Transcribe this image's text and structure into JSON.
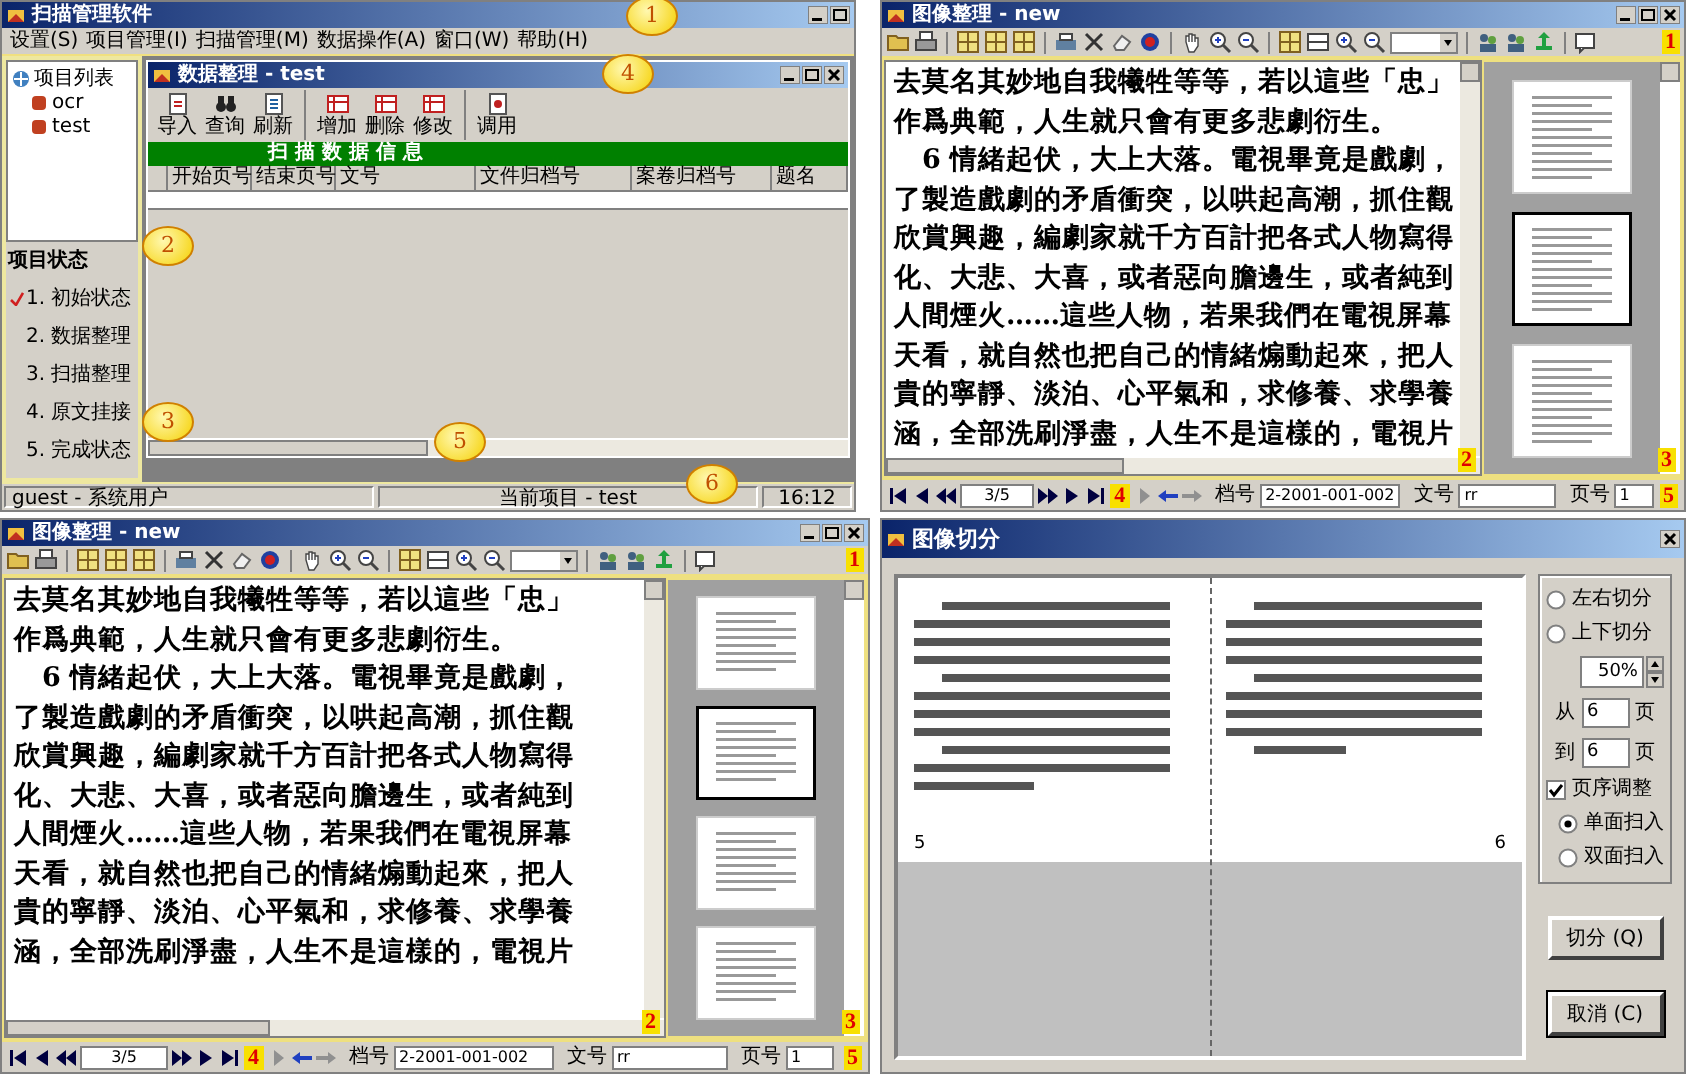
{
  "project_window": {
    "title": "扫描管理软件",
    "menu": [
      "设置(S)",
      "项目管理(I)",
      "扫描管理(M)",
      "数据操作(A)",
      "窗口(W)",
      "帮助(H)"
    ],
    "tree": [
      {
        "label": "项目列表",
        "children": [
          {
            "label": "ocr"
          },
          {
            "label": "test"
          }
        ]
      }
    ],
    "status_panel": {
      "title": "项目状态",
      "items": [
        {
          "label": "1. 初始状态",
          "checked": true
        },
        {
          "label": "2. 数据整理",
          "checked": false
        },
        {
          "label": "3. 扫描整理",
          "checked": false
        },
        {
          "label": "4. 原文挂接",
          "checked": false
        },
        {
          "label": "5. 完成状态",
          "checked": false
        }
      ]
    },
    "data_window": {
      "title": "数据整理 - test",
      "toolbar": [
        "导入",
        "查询",
        "刷新",
        "增加",
        "删除",
        "修改",
        "调用"
      ],
      "banner": "扫 描 数 据 信 息",
      "columns": [
        "开始页号",
        "结束页号",
        "文号",
        "文件归档号",
        "案卷归档号",
        "题名"
      ]
    },
    "status_bar": [
      "guest - 系统用户",
      "当前项目 - test",
      "16:12"
    ],
    "callouts": [
      "1",
      "2",
      "3",
      "4",
      "5",
      "6"
    ]
  },
  "image_windows": [
    {
      "title": "图像整理 - new",
      "lines": [
        "去莫名其妙地自我犧牲等等，若以這些「忠」",
        "作爲典範，人生就只會有更多悲劇衍生。",
        "6 情緒起伏，大上大落。電視畢竟是戲劇，",
        "了製造戲劇的矛盾衝突，以哄起高潮，抓住觀",
        "欣賞興趣，編劇家就千方百計把各式人物寫得",
        "化、大悲、大喜，或者惡向膽邊生，或者純到",
        "人間煙火……這些人物，若果我們在電視屏幕",
        "天看，就自然也把自己的情緒煽動起來，把人",
        "貴的寧靜、淡泊、心平氣和，求修養、求學養",
        "涵，全部洗刷淨盡，人生不是這樣的，電視片"
      ],
      "thumbnails": [
        {
          "selected": false
        },
        {
          "selected": true
        },
        {
          "selected": false
        }
      ],
      "nav": {
        "page": "3/5",
        "fields": [
          {
            "label": "档号",
            "value": "2-2001-001-002"
          },
          {
            "label": "文号",
            "value": "rr"
          },
          {
            "label": "页号",
            "value": "1"
          }
        ]
      },
      "callouts": [
        "1",
        "2",
        "3",
        "4",
        "5"
      ]
    },
    {
      "title": "图像整理 - new",
      "lines": [
        "去莫名其妙地自我犧牲等等，若以這些「忠」",
        "作爲典範，人生就只會有更多悲劇衍生。",
        "6 情緒起伏，大上大落。電視畢竟是戲劇，",
        "了製造戲劇的矛盾衝突，以哄起高潮，抓住觀",
        "欣賞興趣，編劇家就千方百計把各式人物寫得",
        "化、大悲、大喜，或者惡向膽邊生，或者純到",
        "人間煙火……這些人物，若果我們在電視屏幕",
        "天看，就自然也把自己的情緒煽動起來，把人",
        "貴的寧靜、淡泊、心平氣和，求修養、求學養",
        "涵，全部洗刷淨盡，人生不是這樣的，電視片"
      ],
      "thumbnails": [
        {
          "selected": false
        },
        {
          "selected": true
        },
        {
          "selected": false
        },
        {
          "selected": false
        }
      ],
      "nav": {
        "page": "3/5",
        "fields": [
          {
            "label": "档号",
            "value": "2-2001-001-002"
          },
          {
            "label": "文号",
            "value": "rr"
          },
          {
            "label": "页号",
            "value": "1"
          }
        ]
      },
      "callouts": [
        "1",
        "2",
        "3",
        "4",
        "5"
      ]
    }
  ],
  "split_dialog": {
    "title": "图像切分",
    "page_numbers": [
      "5",
      "6"
    ],
    "split_modes": [
      {
        "label": "左右切分",
        "selected": false
      },
      {
        "label": "上下切分",
        "selected": false
      }
    ],
    "ratio": "50%",
    "range": [
      {
        "label": "从",
        "value": "6",
        "unit": "页"
      },
      {
        "label": "到",
        "value": "6",
        "unit": "页"
      }
    ],
    "reorder": {
      "label": "页序调整",
      "checked": true
    },
    "scan_modes": [
      {
        "label": "单面扫入",
        "selected": true
      },
      {
        "label": "双面扫入",
        "selected": false
      }
    ],
    "buttons": [
      {
        "label": "切分 (Q)",
        "default": false
      },
      {
        "label": "取消 (C)",
        "default": true
      }
    ]
  }
}
